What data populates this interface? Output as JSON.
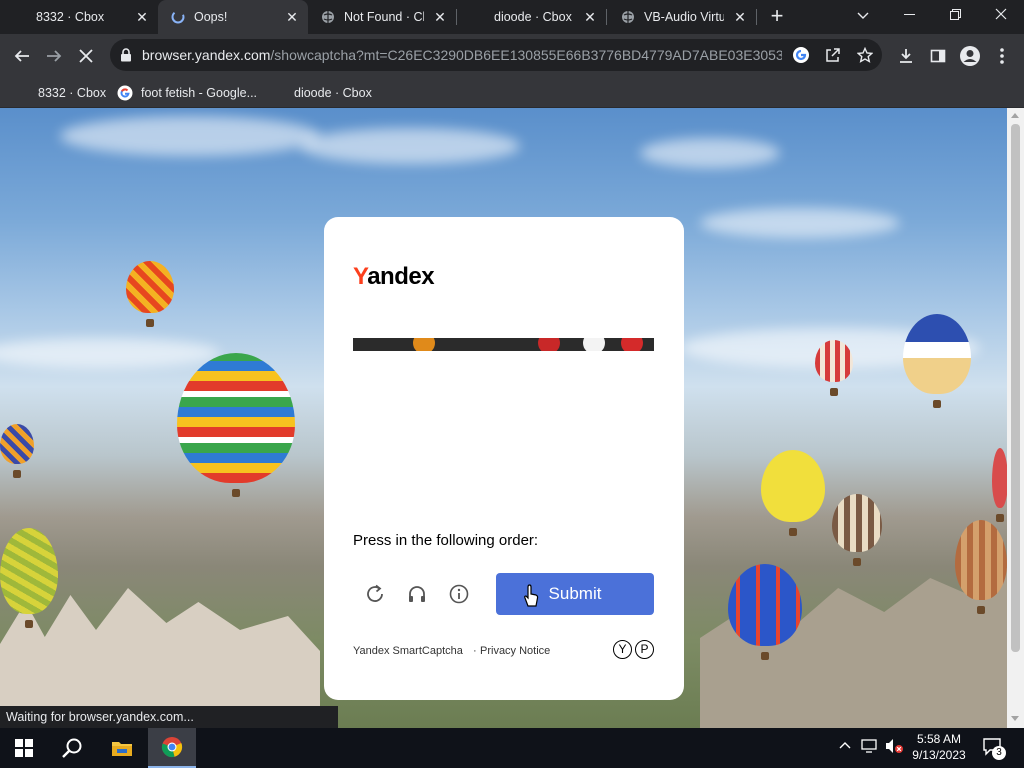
{
  "tabs": [
    {
      "title": "8332 · Cbox",
      "icon": "cbox-icon"
    },
    {
      "title": "Oops!",
      "icon": "loading-spinner-icon"
    },
    {
      "title": "Not Found · Cbox",
      "icon": "globe-icon"
    },
    {
      "title": "dioode · Cbox",
      "icon": "cbox-icon"
    },
    {
      "title": "VB-Audio Virtual",
      "icon": "globe-icon"
    }
  ],
  "toolbar": {
    "url_host": "browser.yandex.com",
    "url_path": "/showcaptcha?mt=C26EC3290DB6EE130855E66B3776BD4779AD7ABE03E30539B..."
  },
  "bookmarks": [
    {
      "label": "8332 · Cbox",
      "icon": "cbox-icon"
    },
    {
      "label": "foot fetish - Google...",
      "icon": "google-icon"
    },
    {
      "label": "dioode · Cbox",
      "icon": "cbox-icon"
    }
  ],
  "captcha": {
    "logo_first": "Y",
    "logo_rest": "andex",
    "instruction": "Press in the following order:",
    "submit_label": "Submit",
    "footer_brand": "Yandex SmartCaptcha",
    "footer_sep": "·",
    "footer_privacy": "Privacy Notice",
    "brand_glyph_1": "Y",
    "brand_glyph_2": "P",
    "accent_color": "#4b71d9",
    "logo_color": "#fc3f1d"
  },
  "status_text": "Waiting for browser.yandex.com...",
  "taskbar": {
    "time": "5:58 AM",
    "date": "9/13/2023",
    "notification_count": "3"
  }
}
